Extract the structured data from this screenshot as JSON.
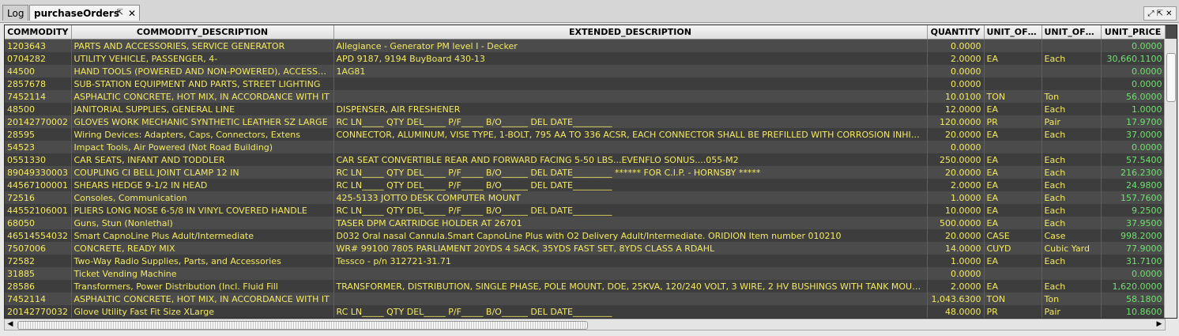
{
  "tabs": [
    {
      "label": "Log",
      "active": false
    },
    {
      "label": "purchaseOrders",
      "active": true
    }
  ],
  "columns": [
    "COMMODITY",
    "COMMODITY_DESCRIPTION",
    "EXTENDED_DESCRIPTION",
    "QUANTITY",
    "UNIT_OF_...",
    "UNIT_OF_...",
    "UNIT_PRICE"
  ],
  "rows": [
    [
      "1203643",
      "PARTS AND ACCESSORIES, SERVICE GENERATOR",
      "Allegiance - Generator PM level I - Decker",
      "0.0000",
      "",
      "",
      "0.0000"
    ],
    [
      "0704282",
      "UTILITY VEHICLE, PASSENGER, 4-",
      "APD 9187, 9194  BuyBoard  430-13",
      "2.0000",
      "EA",
      "Each",
      "30,660.1100"
    ],
    [
      "44500",
      "HAND TOOLS (POWERED AND NON-POWERED), ACCESSORIES",
      "1AG81",
      "0.0000",
      "",
      "",
      "0.0000"
    ],
    [
      "2857678",
      "SUB-STATION EQUIPMENT AND PARTS, STREET LIGHTING",
      "",
      "0.0000",
      "",
      "",
      "0.0000"
    ],
    [
      "7452114",
      "ASPHALTIC CONCRETE, HOT MIX, IN ACCORDANCE WITH IT",
      "",
      "10.0100",
      "TON",
      "Ton",
      "56.0000"
    ],
    [
      "48500",
      "JANITORIAL SUPPLIES, GENERAL LINE",
      "DISPENSER, AIR FRESHENER",
      "12.0000",
      "EA",
      "Each",
      "1.0000"
    ],
    [
      "20142770002",
      "GLOVES WORK MECHANIC SYNTHETIC LEATHER SZ LARGE",
      "RC LN_____ QTY DEL_____ P/F_____ B/O______ DEL DATE_________",
      "120.0000",
      "PR",
      "Pair",
      "17.9700"
    ],
    [
      "28595",
      "Wiring Devices: Adapters, Caps, Connectors, Extens",
      "CONNECTOR, ALUMINUM, VISE TYPE, 1-BOLT, 795 AA TO 336 ACSR,   EACH CONNECTOR SHALL BE PREFILLED WITH CORROSION INHIBITOR",
      "20.0000",
      "EA",
      "Each",
      "37.0000"
    ],
    [
      "54523",
      "Impact Tools, Air Powered (Not Road Building)",
      "",
      "0.0000",
      "",
      "",
      "0.0000"
    ],
    [
      "0551330",
      "CAR SEATS, INFANT AND TODDLER",
      "CAR SEAT CONVERTIBLE REAR AND FORWARD FACING 5-50 LBS...EVENFLO SONUS....055-M2",
      "250.0000",
      "EA",
      "Each",
      "57.5400"
    ],
    [
      "89049330003",
      "COUPLING CI BELL JOINT CLAMP 12 IN",
      "RC LN_____ QTY DEL_____ P/F_____ B/O______ DEL DATE_________    ****** FOR C.I.P.  - HORNSBY *****",
      "20.0000",
      "EA",
      "Each",
      "216.2300"
    ],
    [
      "44567100001",
      "SHEARS HEDGE 9-1/2 IN HEAD",
      "RC LN_____ QTY DEL_____ P/F_____ B/O______ DEL DATE_________",
      "2.0000",
      "EA",
      "Each",
      "24.9800"
    ],
    [
      "72516",
      "Consoles, Communication",
      "425-5133  JOTTO DESK COMPUTER MOUNT",
      "1.0000",
      "EA",
      "Each",
      "157.7600"
    ],
    [
      "44552106001",
      "PLIERS LONG NOSE 6-5/8 IN VINYL COVERED HANDLE",
      "RC LN_____ QTY DEL_____ P/F_____ B/O______ DEL DATE_________",
      "10.0000",
      "EA",
      "Each",
      "9.2500"
    ],
    [
      "68050",
      "Guns, Stun (Nonlethal)",
      "TASER DPM CARTRIDGE HOLDER AT 26701",
      "500.0000",
      "EA",
      "Each",
      "37.9500"
    ],
    [
      "46514554032",
      "Smart CapnoLine Plus Adult/Intermediate",
      "D032   Oral nasal Cannula.Smart CapnoLine Plus with O2 Delivery Adult/Intermediate.    ORIDION  Item number  010210",
      "20.0000",
      "CASE",
      "Case",
      "998.2000"
    ],
    [
      "7507006",
      "CONCRETE, READY MIX",
      "WR# 99100 7805  PARLIAMENT    20YDS 4 SACK, 35YDS FAST SET, 8YDS CLASS A    RDAHL",
      "14.0000",
      "CUYD",
      "Cubic Yard",
      "77.9000"
    ],
    [
      "72582",
      "Two-Way Radio Supplies, Parts, and Accessories",
      "Tessco - p/n 312721-31.71",
      "1.0000",
      "EA",
      "Each",
      "31.7100"
    ],
    [
      "31885",
      "Ticket Vending Machine",
      "",
      "0.0000",
      "",
      "",
      "0.0000"
    ],
    [
      "28586",
      "Transformers, Power Distribution (Incl. Fluid Fill",
      "TRANSFORMER, DISTRIBUTION, SINGLE PHASE, POLE MOUNT, DOE, 25KVA, 120/240  VOLT, 3 WIRE, 2 HV BUSHINGS WITH TANK MOUNTED ARRESTER",
      "2.0000",
      "EA",
      "Each",
      "1,620.0000"
    ],
    [
      "7452114",
      "ASPHALTIC CONCRETE, HOT MIX, IN ACCORDANCE WITH IT",
      "",
      "1,043.6300",
      "TON",
      "Ton",
      "58.1800"
    ],
    [
      "20142770032",
      "Glove Utility Fast Fit Size XLarge",
      "RC LN_____ QTY DEL_____ P/F_____ B/O______ DEL DATE_________",
      "48.0000",
      "PR",
      "Pair",
      "10.8600"
    ]
  ],
  "icons": {
    "pin": "pin-icon",
    "close": "close-icon",
    "window": "window-controls-icon"
  }
}
